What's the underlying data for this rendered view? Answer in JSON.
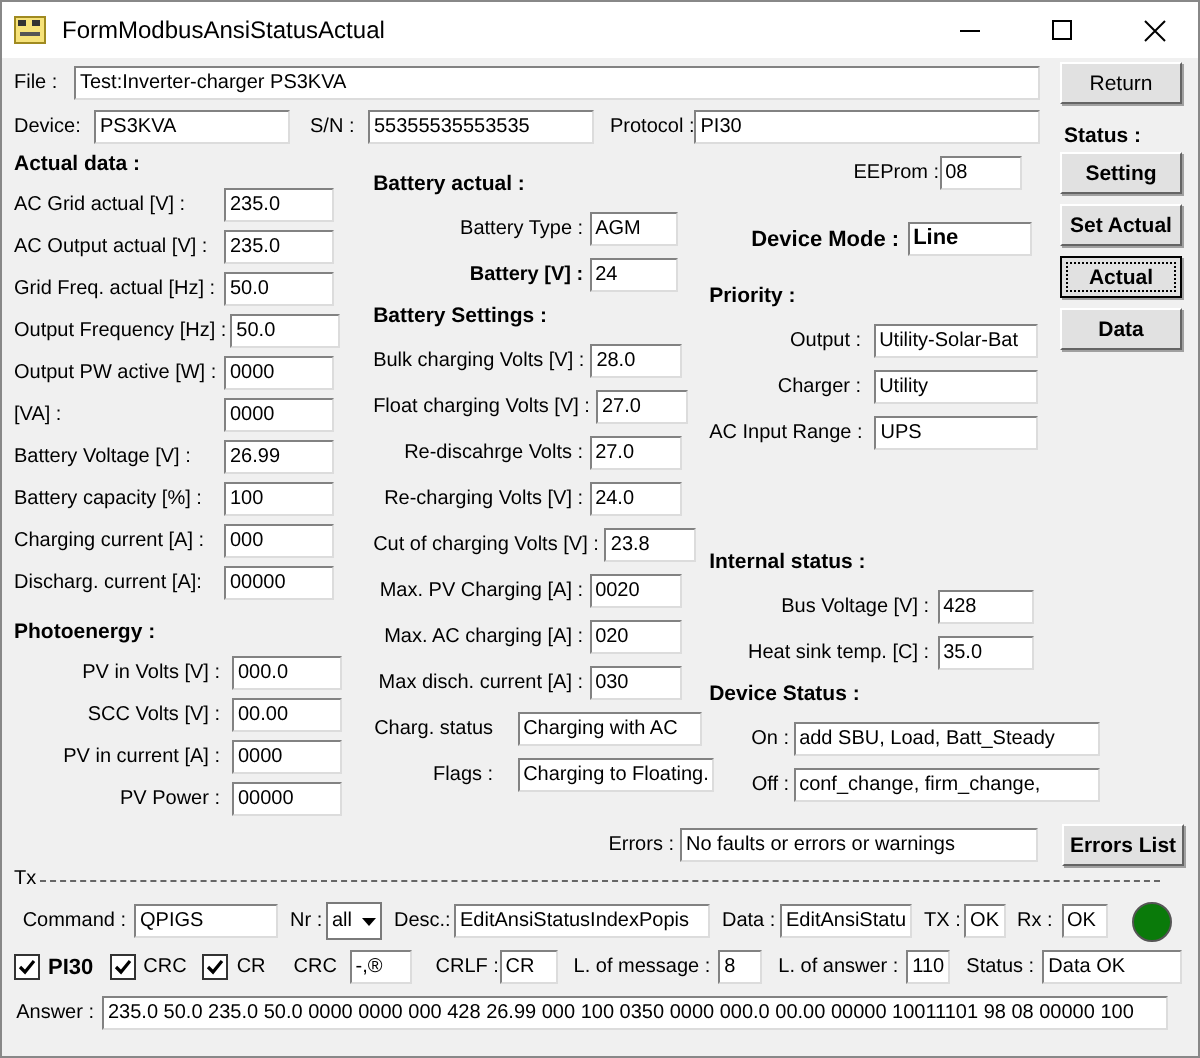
{
  "window": {
    "title": "FormModbusAnsiStatusActual"
  },
  "header": {
    "file": {
      "label": "File :",
      "value": "Test:Inverter-charger PS3KVA"
    },
    "device": {
      "label": "Device:",
      "value": "PS3KVA"
    },
    "sn": {
      "label": "S/N :",
      "value": "55355535553535"
    },
    "protocol": {
      "label": "Protocol :",
      "value": "PI30"
    }
  },
  "return_button": "Return",
  "status_title": "Status :",
  "side_buttons": [
    {
      "label": "Setting",
      "focused": false
    },
    {
      "label": "Set Actual",
      "focused": false
    },
    {
      "label": "Actual",
      "focused": true
    },
    {
      "label": "Data",
      "focused": false
    }
  ],
  "actual_data": {
    "title": "Actual  data :",
    "rows": [
      {
        "label": "AC Grid actual [V] :",
        "value": "235.0"
      },
      {
        "label": "AC Output actual [V] :",
        "value": "235.0"
      },
      {
        "label": "Grid Freq. actual [Hz] :",
        "value": "50.0"
      },
      {
        "label": "Output Frequency [Hz] :",
        "value": "50.0"
      },
      {
        "label": "Output PW active [W] :",
        "value": "0000"
      },
      {
        "label": "[VA] :",
        "value": "0000"
      },
      {
        "label": "Battery Voltage [V] :",
        "value": "26.99"
      },
      {
        "label": "Battery capacity [%] :",
        "value": "100"
      },
      {
        "label": "Charging current  [A] :",
        "value": "000"
      },
      {
        "label": "Discharg. current [A]:",
        "value": "00000"
      }
    ]
  },
  "photoenergy": {
    "title": "Photoenergy :",
    "rows": [
      {
        "label": "PV in Volts [V] :",
        "value": "000.0"
      },
      {
        "label": "SCC Volts [V] :",
        "value": "00.00"
      },
      {
        "label": "PV in current [A] :",
        "value": "0000"
      },
      {
        "label": "PV Power :",
        "value": "00000"
      }
    ]
  },
  "battery_actual": {
    "title": "Battery actual :",
    "rows": [
      {
        "label": "Battery Type :",
        "value": "AGM",
        "bold": false
      },
      {
        "label": "Battery [V] :",
        "value": "24",
        "bold": true
      }
    ]
  },
  "battery_settings": {
    "title": "Battery Settings :",
    "rows": [
      {
        "label": "Bulk charging Volts [V] :",
        "value": "28.0"
      },
      {
        "label": "Float charging Volts [V] :",
        "value": "27.0"
      },
      {
        "label": "Re-discahrge Volts :",
        "value": "27.0"
      },
      {
        "label": "Re-charging Volts [V] :",
        "value": "24.0"
      },
      {
        "label": "Cut of charging Volts [V] :",
        "value": "23.8"
      },
      {
        "label": "Max. PV Charging [A] :",
        "value": "0020"
      },
      {
        "label": "Max. AC charging [A] :",
        "value": "020"
      },
      {
        "label": "Max disch. current [A] :",
        "value": "030"
      }
    ]
  },
  "charge_info": [
    {
      "label": "Charg. status",
      "value": "Charging with AC"
    },
    {
      "label": "Flags :",
      "value": "Charging to Floating."
    }
  ],
  "eeprom": {
    "label": "EEProm :",
    "value": "08"
  },
  "device_mode": {
    "label": "Device Mode :",
    "value": "Line"
  },
  "priority": {
    "title": "Priority :",
    "rows": [
      {
        "label": "Output :",
        "value": "Utility-Solar-Bat"
      },
      {
        "label": "Charger :",
        "value": "Utility"
      },
      {
        "label": "AC Input Range :",
        "value": "UPS"
      }
    ]
  },
  "internal_status": {
    "title": "Internal status :",
    "rows": [
      {
        "label": "Bus Voltage [V] :",
        "value": "428"
      },
      {
        "label": "Heat sink temp. [C] :",
        "value": "35.0"
      }
    ]
  },
  "device_status": {
    "title": "Device Status :",
    "rows": [
      {
        "label": "On :",
        "value": "add SBU, Load, Batt_Steady"
      },
      {
        "label": "Off :",
        "value": "conf_change, firm_change,"
      }
    ]
  },
  "errors": {
    "label": "Errors :",
    "value": "No faults or errors or warnings",
    "button": "Errors List"
  },
  "tx": {
    "title": "Tx",
    "command": {
      "label": "Command :",
      "value": "QPIGS"
    },
    "nr": {
      "label": "Nr :",
      "value": "all"
    },
    "desc": {
      "label": "Desc.:",
      "value": "EditAnsiStatusIndexPopis"
    },
    "data": {
      "label": "Data :",
      "value": "EditAnsiStatu"
    },
    "tx_state": {
      "label": "TX :",
      "value": "OK"
    },
    "rx_state": {
      "label": "Rx :",
      "value": "OK"
    },
    "led": {
      "on": true
    },
    "checkboxes": [
      {
        "label": "PI30",
        "checked": true,
        "bold": true
      },
      {
        "label": "CRC",
        "checked": true,
        "bold": false
      },
      {
        "label": "CR",
        "checked": true,
        "bold": false
      }
    ],
    "crc": {
      "label": "CRC",
      "value": "-,®"
    },
    "crlf": {
      "label": "CRLF :",
      "value": "CR"
    },
    "msg_len": {
      "label": "L. of message :",
      "value": "8"
    },
    "ans_len": {
      "label": "L. of answer :",
      "value": "110"
    },
    "status": {
      "label": "Status :",
      "value": "Data OK"
    },
    "answer": {
      "label": "Answer :",
      "value": "235.0 50.0 235.0 50.0 0000 0000 000 428 26.99 000 100 0350 0000 000.0 00.00 00000 10011101 98 08 00000 100"
    }
  }
}
